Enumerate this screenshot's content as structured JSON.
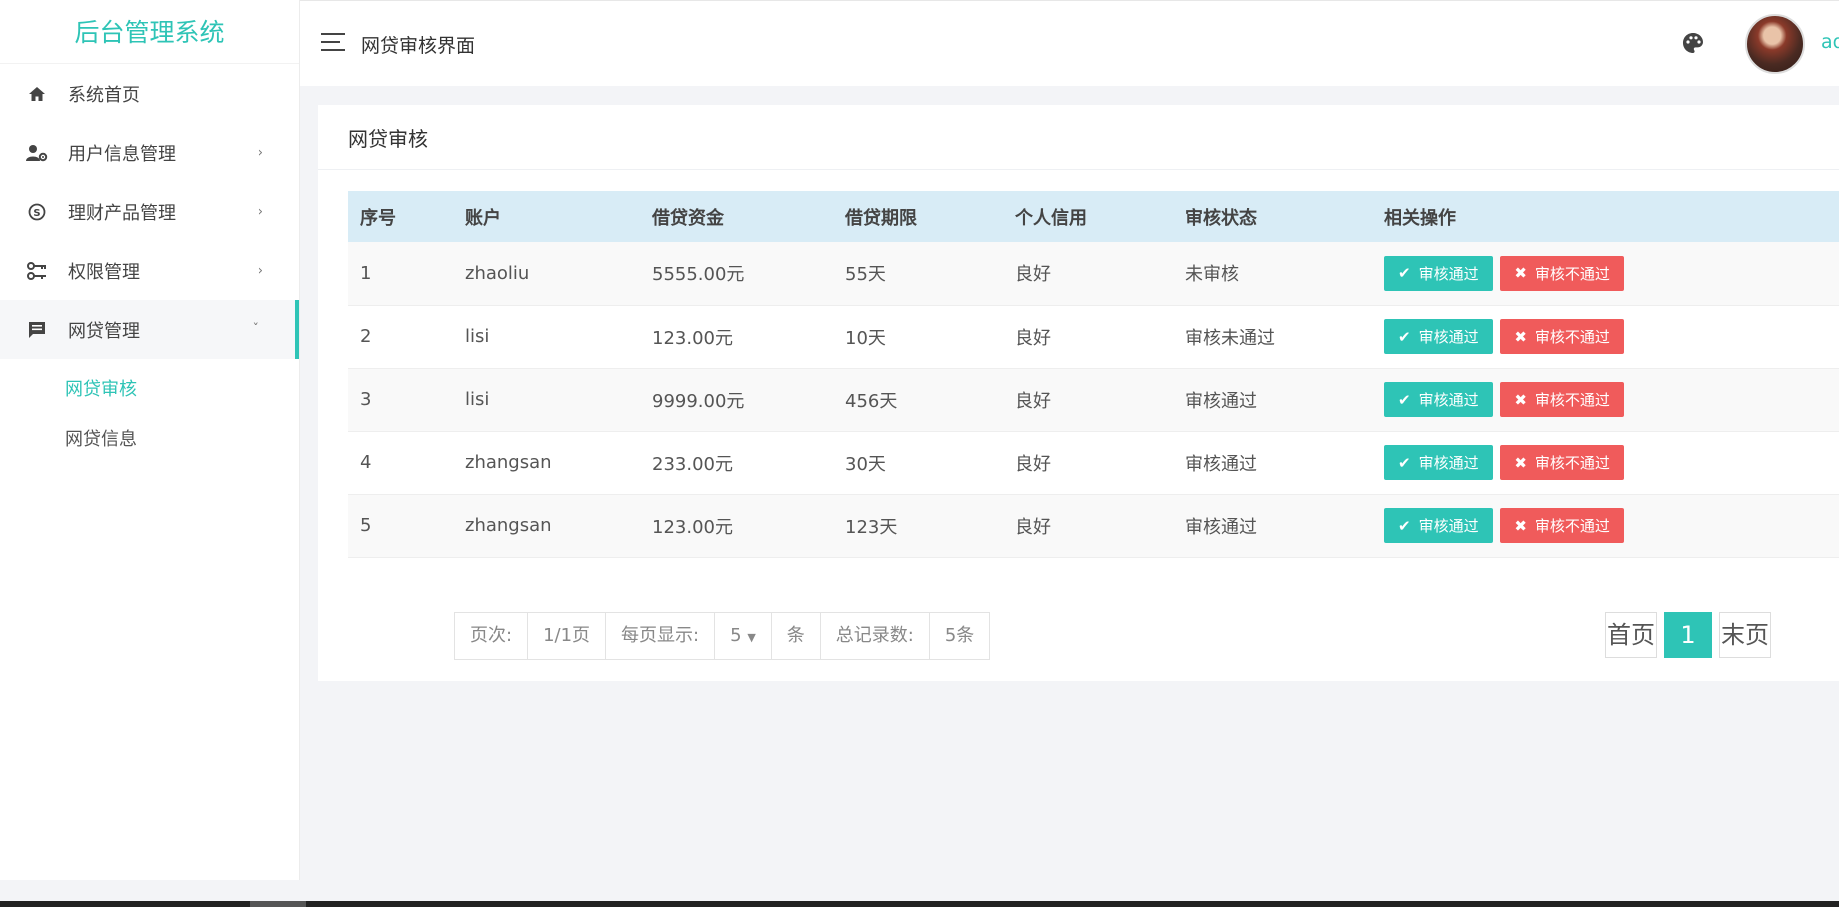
{
  "app": {
    "title": "后台管理系统"
  },
  "sidebar": {
    "items": [
      {
        "label": "系统首页",
        "icon": "home-icon"
      },
      {
        "label": "用户信息管理",
        "icon": "user-settings-icon"
      },
      {
        "label": "理财产品管理",
        "icon": "skype-icon"
      },
      {
        "label": "权限管理",
        "icon": "key-icon"
      },
      {
        "label": "网贷管理",
        "icon": "message-icon"
      }
    ],
    "chevrons": {
      "collapsed": "›",
      "expanded": "ˇ"
    },
    "submenu": [
      {
        "label": "网贷审核"
      },
      {
        "label": "网贷信息"
      }
    ]
  },
  "header": {
    "title": "网贷审核界面",
    "username": "admin"
  },
  "card": {
    "title": "网贷审核"
  },
  "table": {
    "columns": [
      "序号",
      "账户",
      "借贷资金",
      "借贷期限",
      "个人信用",
      "审核状态",
      "相关操作"
    ],
    "rows": [
      [
        "1",
        "zhaoliu",
        "5555.00元",
        "55天",
        "良好",
        "未审核"
      ],
      [
        "2",
        "lisi",
        "123.00元",
        "10天",
        "良好",
        "审核未通过"
      ],
      [
        "3",
        "lisi",
        "9999.00元",
        "456天",
        "良好",
        "审核通过"
      ],
      [
        "4",
        "zhangsan",
        "233.00元",
        "30天",
        "良好",
        "审核通过"
      ],
      [
        "5",
        "zhangsan",
        "123.00元",
        "123天",
        "良好",
        "审核通过"
      ]
    ],
    "actions": {
      "approve": "审核通过",
      "reject": "审核不通过",
      "approve_icon": "✔",
      "reject_icon": "✖"
    }
  },
  "pagination": {
    "page_label": "页次:",
    "page_value": "1/1页",
    "per_page_label": "每页显示:",
    "per_page_value": "5",
    "per_page_unit": "条",
    "total_label": "总记录数:",
    "total_value": "5条",
    "first": "首页",
    "current": "1",
    "last": "末页"
  },
  "colors": {
    "accent": "#2ec4b6",
    "danger": "#f05b5b",
    "table_header": "#d8ecf6"
  }
}
